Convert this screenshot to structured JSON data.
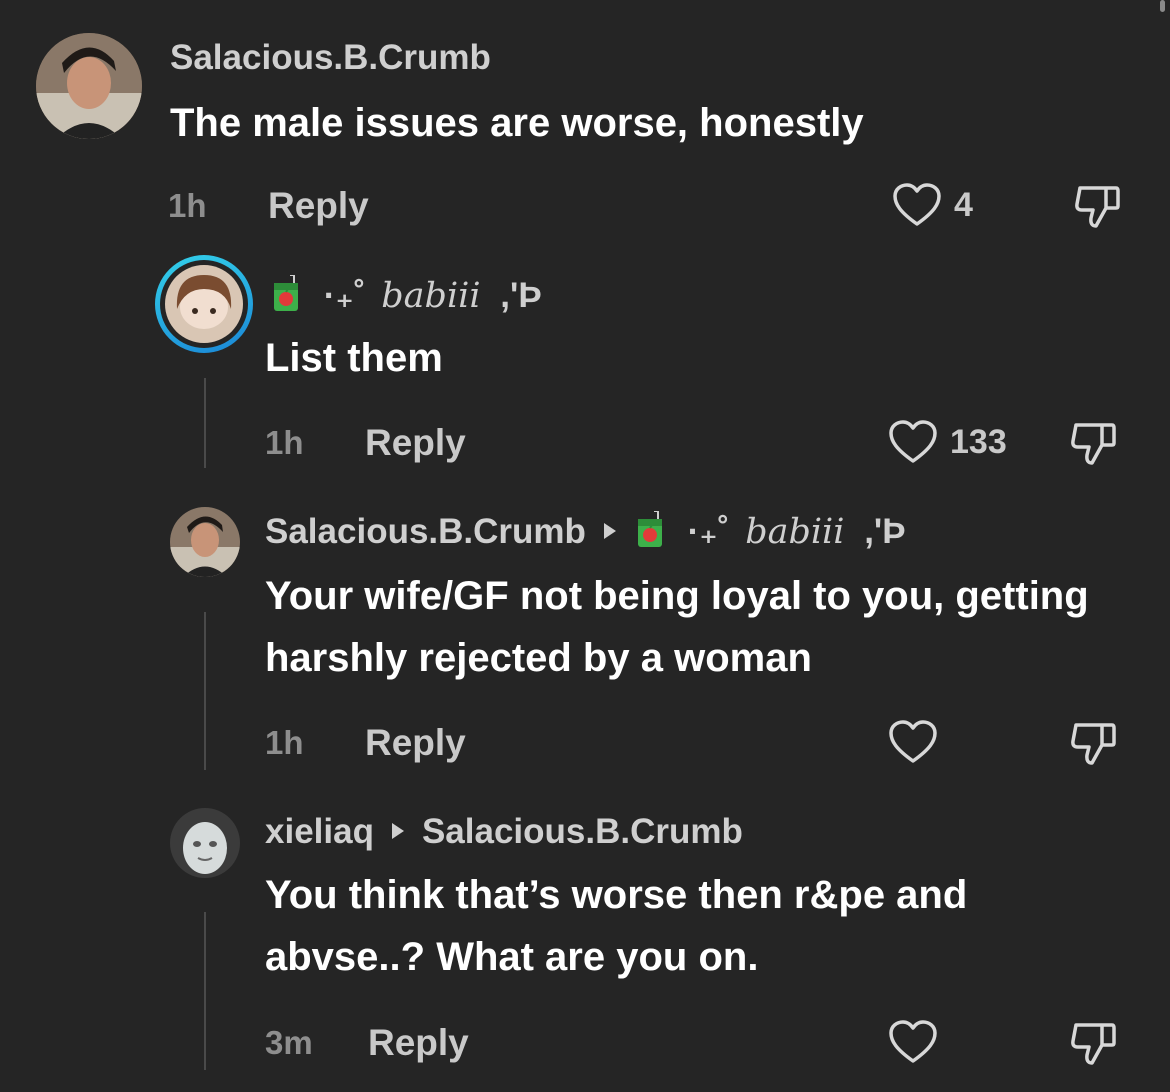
{
  "comments": [
    {
      "username": "Salacious.B.Crumb",
      "text": "The male issues are worse, honestly",
      "time": "1h",
      "reply_label": "Reply",
      "likes": "4"
    },
    {
      "username_prefix": "·₊˚",
      "username": "babiii",
      "username_suffix": ",'Þ",
      "text": "List them",
      "time": "1h",
      "reply_label": "Reply",
      "likes": "133"
    },
    {
      "username": "Salacious.B.Crumb",
      "reply_to_prefix": "·₊˚",
      "reply_to": "babiii",
      "reply_to_suffix": ",'Þ",
      "text": "Your wife/GF not being loyal to you, getting harshly rejected by a woman",
      "time": "1h",
      "reply_label": "Reply",
      "likes": ""
    },
    {
      "username": "xieliaq",
      "reply_to": "Salacious.B.Crumb",
      "text": "You think that’s worse then r&pe and abvse..? What are you on.",
      "time": "3m",
      "reply_label": "Reply",
      "likes": ""
    }
  ],
  "colors": {
    "background": "#252525",
    "story_ring_start": "#2ec4e8",
    "story_ring_end": "#1f8fd8"
  },
  "icons": [
    "heart-outline-icon",
    "thumbs-down-icon",
    "juice-box-emoji",
    "caret-right-icon"
  ]
}
